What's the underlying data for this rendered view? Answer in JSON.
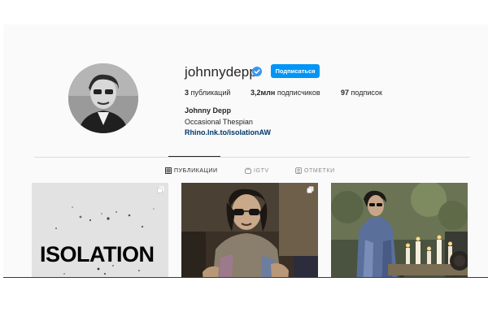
{
  "profile": {
    "username": "johnnydepp",
    "follow_label": "Подписаться",
    "full_name": "Johnny Depp",
    "bio": "Occasional Thespian",
    "link": "Rhino.lnk.to/isolationAW",
    "stats": {
      "posts_value": "3",
      "posts_label": "публикаций",
      "followers_value": "3,2млн",
      "followers_label": "подписчиков",
      "following_value": "97",
      "following_label": "подписок"
    }
  },
  "tabs": [
    {
      "label": "ПУБЛИКАЦИИ",
      "icon": "grid-icon",
      "active": true
    },
    {
      "label": "IGTV",
      "icon": "igtv-icon",
      "active": false
    },
    {
      "label": "ОТМЕТКИ",
      "icon": "tag-icon",
      "active": false
    }
  ],
  "posts": [
    {
      "overlay_text": "ISOLATION",
      "icon": "carousel-icon"
    },
    {
      "icon": "carousel-icon"
    },
    {}
  ],
  "colors": {
    "accent": "#0095f6",
    "link": "#00376b",
    "text": "#262626",
    "muted": "#8e8e8e",
    "divider": "#dbdbdb"
  }
}
